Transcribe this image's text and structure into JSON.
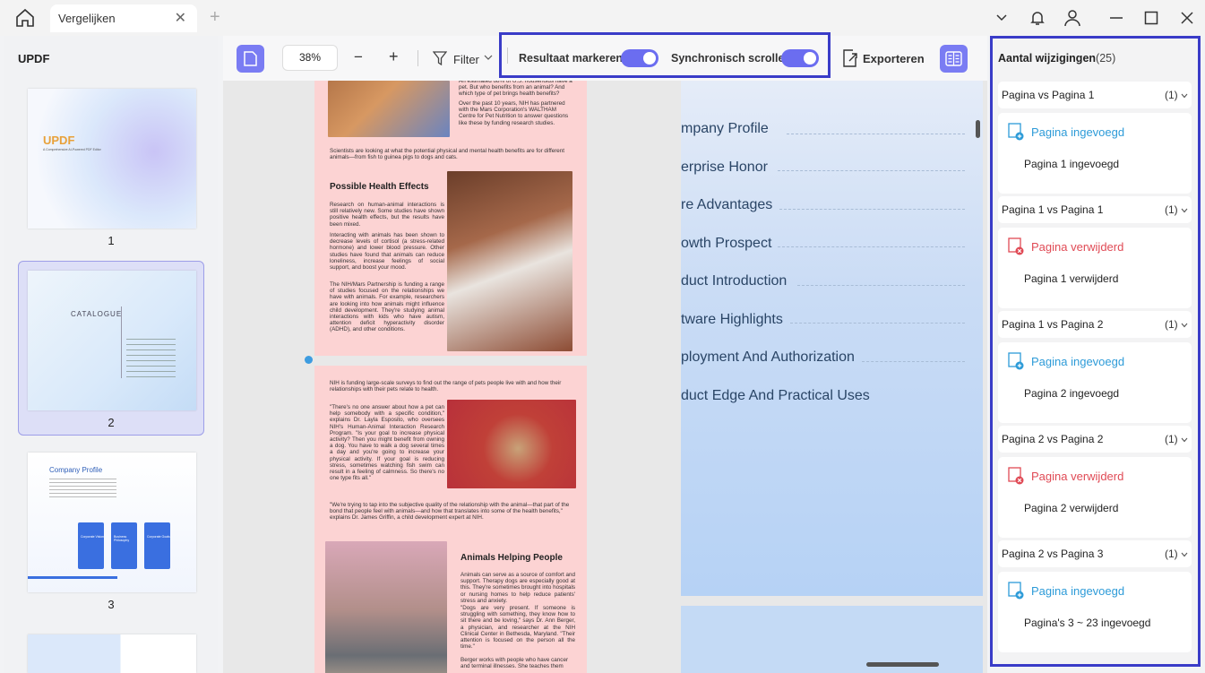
{
  "tab": {
    "title": "Vergelijken",
    "close": "✕",
    "new": "+"
  },
  "sidebar": {
    "title": "UPDF",
    "pages": [
      {
        "num": "1"
      },
      {
        "num": "2"
      },
      {
        "num": "3"
      }
    ],
    "thumb1": {
      "logo": "UPDF",
      "sub": "A Comprehensive AI-Powered PDF Editor"
    },
    "thumb2": {
      "title": "CATALOGUE"
    },
    "thumb3": {
      "title": "Company Profile",
      "cards": [
        "Corporate Vision",
        "Business Philosophy",
        "Corporate Goals"
      ]
    }
  },
  "toolbar": {
    "zoom": "38%",
    "minus": "−",
    "plus": "+",
    "filter": "Filter",
    "mark": "Resultaat markeren",
    "sync": "Synchronisch scrollen",
    "export": "Exporteren"
  },
  "docLeft": {
    "p1_top": "An estimated 68% of U.S. households have a pet. But who benefits from an animal? And which type of pet brings health benefits?",
    "p1_top2": "Over the past 10 years, NIH has partnered with the Mars Corporation's WALTHAM Centre for Pet Nutrition to answer questions like these by funding research studies.",
    "p1_sci": "Scientists are looking at what the potential physical and mental health benefits are for different animals—from fish to guinea pigs to dogs and cats.",
    "h1": "Possible Health Effects",
    "p1_a": "Research on human-animal interactions is still relatively new. Some studies have shown positive health effects, but the results have been mixed.",
    "p1_b": "Interacting with animals has been shown to decrease levels of cortisol (a stress-related hormone) and lower blood pressure. Other studies have found that animals can reduce loneliness, increase feelings of social support, and boost your mood.",
    "p1_c": "The NIH/Mars Partnership is funding a range of studies focused on the relationships we have with animals. For example, researchers are looking into how animals might influence child development. They're studying animal interactions with kids who have autism, attention deficit hyperactivity disorder (ADHD), and other conditions.",
    "p2_a": "NIH is funding large-scale surveys to find out the range of pets people live with and how their relationships with their pets relate to health.",
    "p2_b": "\"There's no one answer about how a pet can help somebody with a specific condition,\" explains Dr. Layla Esposito, who oversees NIH's Human-Animal Interaction Research Program. \"Is your goal to increase physical activity? Then you might benefit from owning a dog. You have to walk a dog several times a day and you're going to increase your physical activity. If your goal is reducing stress, sometimes watching fish swim can result in a feeling of calmness. So there's no one type fits all.\"",
    "p2_c": "\"We're trying to tap into the subjective quality of the relationship with the animal—that part of the bond that people feel with animals—and how that translates into some of the health benefits,\" explains Dr. James Griffin, a child development expert at NIH.",
    "h2": "Animals Helping People",
    "p2_d": "Animals can serve as a source of comfort and support. Therapy dogs are especially good at this. They're sometimes brought into hospitals or nursing homes to help reduce patients' stress and anxiety.",
    "p2_e": "\"Dogs are very present. If someone is struggling with something, they know how to sit there and be loving,\" says Dr. Ann Berger, a physician, and researcher at the NIH Clinical Center in Bethesda, Maryland. \"Their attention is focused on the person all the time.\"",
    "p2_f": "Berger works with people who have cancer and terminal illnesses. She teaches them"
  },
  "docRight": {
    "toc": [
      "mpany Profile",
      "erprise Honor",
      "re Advantages",
      "owth Prospect",
      "duct Introduction",
      "tware Highlights",
      "ployment And Authorization",
      "duct Edge And Practical Uses"
    ]
  },
  "changes": {
    "title": "Aantal wijzigingen",
    "count": "(25)",
    "groups": [
      {
        "header": "Pagina  vs Pagina 1",
        "count": "(1)",
        "type": "add",
        "label": "Pagina ingevoegd",
        "detail": "Pagina 1 ingevoegd"
      },
      {
        "header": "Pagina 1 vs Pagina 1",
        "count": "(1)",
        "type": "del",
        "label": "Pagina verwijderd",
        "detail": "Pagina 1 verwijderd"
      },
      {
        "header": "Pagina 1 vs Pagina 2",
        "count": "(1)",
        "type": "add",
        "label": "Pagina ingevoegd",
        "detail": "Pagina 2 ingevoegd"
      },
      {
        "header": "Pagina 2 vs Pagina 2",
        "count": "(1)",
        "type": "del",
        "label": "Pagina verwijderd",
        "detail": "Pagina 2 verwijderd"
      },
      {
        "header": "Pagina 2 vs Pagina 3",
        "count": "(1)",
        "type": "add",
        "label": "Pagina ingevoegd",
        "detail": "Pagina's 3 ~ 23 ingevoegd"
      }
    ]
  },
  "colors": {
    "accent": "#6b6df0",
    "highlight": "#3a3cc8",
    "added": "#2d9bd8",
    "deleted": "#e04a55"
  }
}
